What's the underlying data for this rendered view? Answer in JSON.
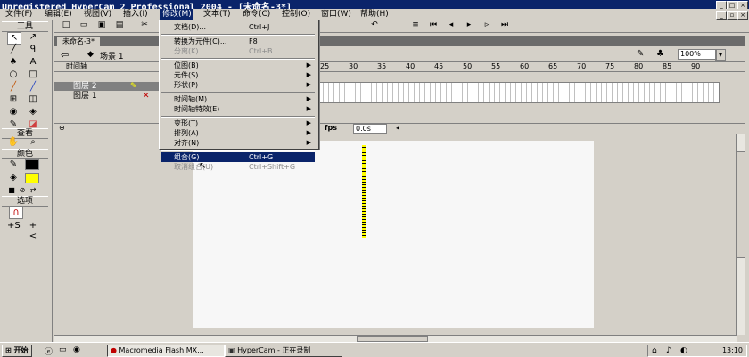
{
  "window": {
    "title": "Unregistered HyperCam 2 Professional 2004 - [未命名-3*]"
  },
  "menubar": {
    "items": [
      "文件(F)",
      "编辑(E)",
      "视图(V)",
      "插入(I)",
      "修改(M)",
      "文本(T)",
      "命令(C)",
      "控制(O)",
      "窗口(W)",
      "帮助(H)"
    ],
    "active_index": 4
  },
  "tools": {
    "header": "工具",
    "view_header": "查看",
    "color_header": "颜色",
    "options_header": "选项"
  },
  "document": {
    "tab": "未命名-3*",
    "scene": "场景 1",
    "zoom": "100%",
    "timeline_label": "时间轴",
    "layers": [
      "图层 2",
      "图层 1"
    ],
    "ruler": [
      "25",
      "30",
      "35",
      "40",
      "45",
      "50",
      "55",
      "60",
      "65",
      "70",
      "75",
      "80",
      "85",
      "90"
    ],
    "fps_label": "fps",
    "time": "0.0s"
  },
  "dropdown": {
    "items": [
      {
        "label": "文档(D)...",
        "shortcut": "Ctrl+J",
        "submenu": false,
        "state": "normal"
      },
      {
        "sep": true
      },
      {
        "label": "转换为元件(C)...",
        "shortcut": "F8",
        "submenu": false,
        "state": "normal"
      },
      {
        "label": "分离(K)",
        "shortcut": "Ctrl+B",
        "submenu": false,
        "state": "disabled"
      },
      {
        "sep": true
      },
      {
        "label": "位图(B)",
        "shortcut": "",
        "submenu": true,
        "state": "normal"
      },
      {
        "label": "元件(S)",
        "shortcut": "",
        "submenu": true,
        "state": "normal"
      },
      {
        "label": "形状(P)",
        "shortcut": "",
        "submenu": true,
        "state": "normal"
      },
      {
        "sep": true
      },
      {
        "label": "时间轴(M)",
        "shortcut": "",
        "submenu": true,
        "state": "normal"
      },
      {
        "label": "时间轴特效(E)",
        "shortcut": "",
        "submenu": true,
        "state": "normal"
      },
      {
        "sep": true
      },
      {
        "label": "变形(T)",
        "shortcut": "",
        "submenu": true,
        "state": "normal"
      },
      {
        "label": "排列(A)",
        "shortcut": "",
        "submenu": true,
        "state": "normal"
      },
      {
        "label": "对齐(N)",
        "shortcut": "",
        "submenu": true,
        "state": "normal"
      },
      {
        "sep": true
      },
      {
        "label": "组合(G)",
        "shortcut": "Ctrl+G",
        "submenu": false,
        "state": "highlighted"
      },
      {
        "label": "取消组合(U)",
        "shortcut": "Ctrl+Shift+G",
        "submenu": false,
        "state": "disabled"
      }
    ]
  },
  "taskbar": {
    "start": "开始",
    "tasks": [
      "Macromedia Flash MX...",
      "HyperCam - 正在录制"
    ],
    "clock": "13:10"
  }
}
